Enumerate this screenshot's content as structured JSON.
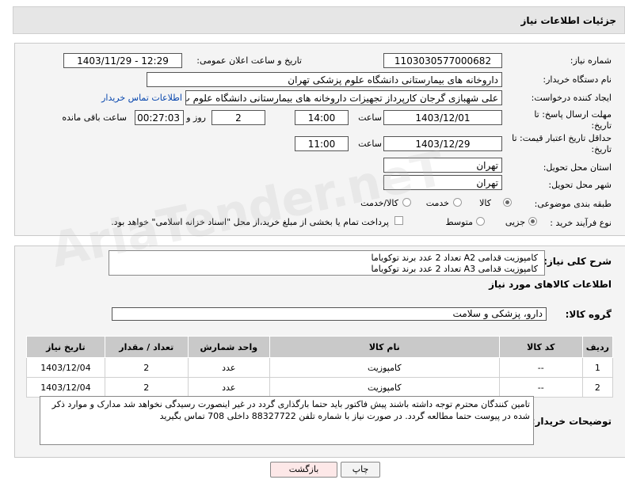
{
  "header": {
    "title": "جزئیات اطلاعات نیاز"
  },
  "form": {
    "need_number_label": "شماره نیاز:",
    "need_number_value": "1103030577000682",
    "announce_label": "تاریخ و ساعت اعلان عمومی:",
    "announce_value": "1403/11/29 - 12:29",
    "buyer_org_label": "نام دستگاه خریدار:",
    "buyer_org_value": "داروخانه های بیمارستانی دانشگاه علوم پزشکی تهران",
    "requester_label": "ایجاد کننده درخواست:",
    "requester_value": "علی شهبازی گرجان کارپرداز تجهیزات داروخانه های بیمارستانی دانشگاه علوم پ",
    "buyer_contact_link": "اطلاعات تماس خریدار",
    "deadline_label_1": "مهلت ارسال پاسخ: تا",
    "deadline_label_2": "تاریخ:",
    "deadline_date": "1403/12/01",
    "time_label": "ساعت",
    "deadline_time": "14:00",
    "days_value": "2",
    "days_label": "روز و",
    "remaining_value": "00:27:03",
    "remaining_label": "ساعت باقی مانده",
    "validity_label_1": "حداقل تاریخ اعتبار قیمت: تا",
    "validity_label_2": "تاریخ:",
    "validity_date": "1403/12/29",
    "validity_time": "11:00",
    "province_label": "استان محل تحویل:",
    "province_value": "تهران",
    "city_label": "شهر محل تحویل:",
    "city_value": "تهران",
    "category_label": "طبقه بندی موضوعی:",
    "category_options": [
      "کالا",
      "خدمت",
      "کالا/خدمت"
    ],
    "category_selected": "کالا",
    "process_label": "نوع فرآیند خرید :",
    "process_options": [
      "جزیی",
      "متوسط"
    ],
    "payment_note": "پرداخت تمام یا بخشی از مبلغ خرید،از محل \"اسناد خزانه اسلامی\" خواهد بود."
  },
  "description": {
    "label": "شرح کلی نیاز:",
    "line1": "کامپوزیت قدامی A2 تعداد 2 عدد برند توکویاما",
    "line2": "کامپوزیت قدامی A3 تعداد 2 عدد برند توکویاما"
  },
  "goods_section": {
    "title": "اطلاعات کالاهای مورد نیاز",
    "group_label": "گروه کالا:",
    "group_value": "دارو، پزشکی و سلامت",
    "columns": [
      "ردیف",
      "کد کالا",
      "نام کالا",
      "واحد شمارش",
      "تعداد / مقدار",
      "تاریخ نیاز"
    ],
    "rows": [
      {
        "row": "1",
        "code": "--",
        "name": "کامپوزیت",
        "unit": "عدد",
        "qty": "2",
        "date": "1403/12/04"
      },
      {
        "row": "2",
        "code": "--",
        "name": "کامپوزیت",
        "unit": "عدد",
        "qty": "2",
        "date": "1403/12/04"
      }
    ]
  },
  "buyer_notes": {
    "label": "توضیحات خریدار:",
    "text": "تامین کنندگان محترم توجه داشته باشند پیش فاکتور باید حتما بارگذاری گردد در غیر اینصورت رسیدگی نخواهد شد مدارک و موارد ذکر شده در پیوست حتما مطالعه گردد. در صورت نیاز با شماره تلفن 88327722 داخلی 708 تماس بگیرید"
  },
  "buttons": {
    "print": "چاپ",
    "back": "بازگشت"
  },
  "watermark": "AriaTender.neT",
  "colors": {
    "header_bg": "#e6e6e6",
    "panel_bg": "#f4f4f4",
    "table_head": "#c9c9c9",
    "back_button": "#fde8e8",
    "link": "#0645ad"
  }
}
